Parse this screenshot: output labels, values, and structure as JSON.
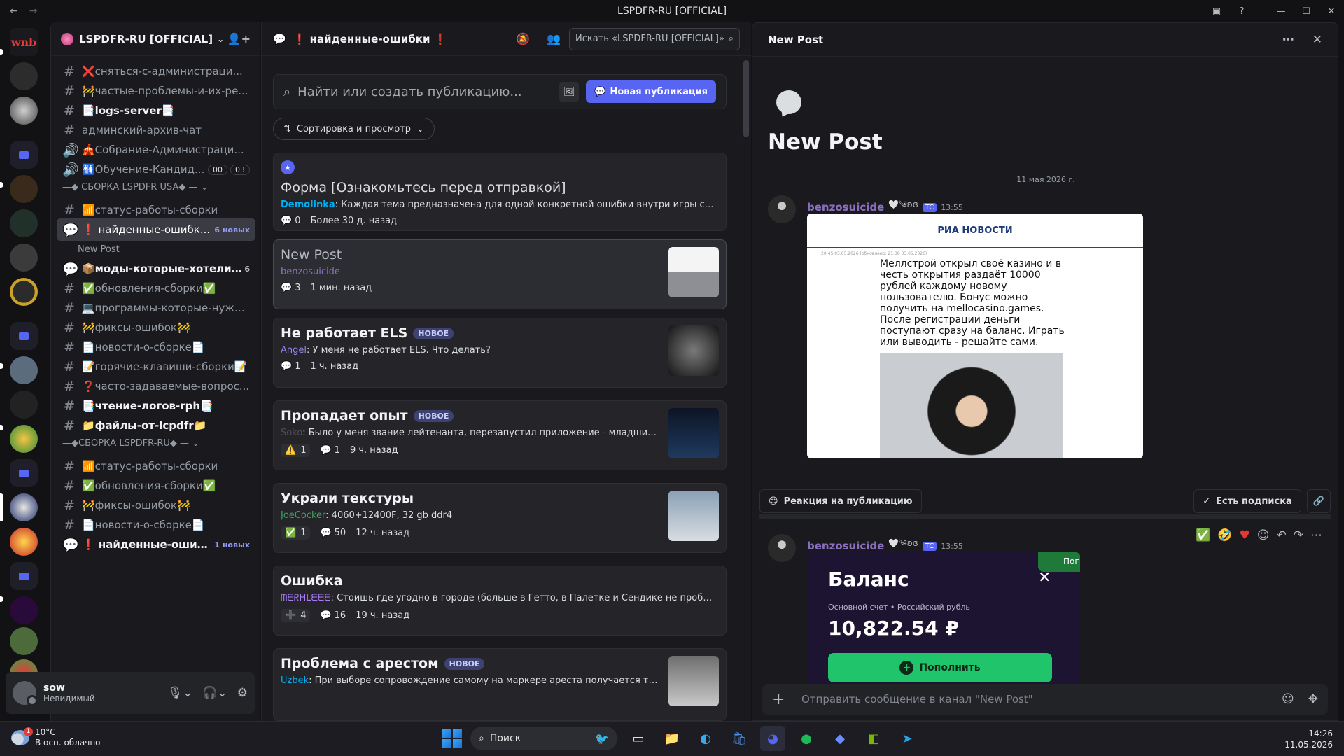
{
  "window": {
    "title": "LSPDFR-RU [OFFICIAL]",
    "back_icon": "arrow-left-icon",
    "forward_icon": "arrow-right-icon"
  },
  "server_sidebar": {
    "items": [
      "wnb"
    ]
  },
  "channels": {
    "guild_name": "LSPDFR-RU [OFFICIAL]",
    "items": [
      {
        "label": "❌сняться-с-администраци...",
        "type": "text"
      },
      {
        "label": "🚧частые-проблемы-и-их-ре...",
        "type": "text"
      },
      {
        "label": "📑logs-server📑",
        "type": "text"
      },
      {
        "label": "админский-архив-чат",
        "type": "text"
      },
      {
        "label": "🎪Собрание-Администраци...",
        "type": "voice"
      },
      {
        "label": "🚻Обучение-Кандид...",
        "type": "voice",
        "counts": [
          "00",
          "03"
        ]
      },
      {
        "label": "📶статус-работы-сборки",
        "type": "text"
      },
      {
        "label": "❗ найденные-ошибк...",
        "type": "forum",
        "badge": "6 новых"
      },
      {
        "label": "New Post",
        "type": "thread"
      },
      {
        "label": "📦моды-которые-хотели-б...",
        "type": "forum",
        "badge": "6"
      },
      {
        "label": "✅обновления-сборки✅",
        "type": "text"
      },
      {
        "label": "💻программы-которые-нужн...",
        "type": "text"
      },
      {
        "label": "🚧фиксы-ошибок🚧",
        "type": "text"
      },
      {
        "label": "📄новости-о-сборке📄",
        "type": "text"
      },
      {
        "label": "📝горячие-клавиши-сборки📝",
        "type": "text"
      },
      {
        "label": "❓часто-задаваемые-вопрос...",
        "type": "text"
      },
      {
        "label": "📑чтение-логов-rph📑",
        "type": "text"
      },
      {
        "label": "📁файлы-от-lcpdfr📁",
        "type": "text"
      },
      {
        "label": "📶статус-работы-сборки",
        "type": "text"
      },
      {
        "label": "✅обновления-сборки✅",
        "type": "text"
      },
      {
        "label": "🚧фиксы-ошибок🚧",
        "type": "text"
      },
      {
        "label": "📄новости-о-сборке📄",
        "type": "text"
      },
      {
        "label": "❗ найденные-ошибки...",
        "type": "forum",
        "badge": "1 новых"
      }
    ],
    "categories": [
      "—◆ СБОРКА LSPDFR USA◆ —",
      "—◆СБОРКА LSPDFR-RU◆ —"
    ]
  },
  "user": {
    "name": "sow",
    "status": "Невидимый"
  },
  "forum": {
    "channel_name": "❗ найденные-ошибки ❗",
    "search_placeholder": "Искать «LSPDFR-RU [OFFICIAL]»",
    "post_search_placeholder": "Найти или создать публикацию...",
    "new_post_label": "Новая публикация",
    "sort_label": "Сортировка и просмотр",
    "posts": [
      {
        "title": "Форма [Ознакомьтесь перед отправкой]",
        "author": "Demolinka",
        "author_color": "#00b0f4",
        "preview": "Каждая тема предназначена для одной конкретной ошибки внутри игры со сборкой. П...",
        "comments": "0",
        "time": "Более 30 д. назад",
        "pinned": true
      },
      {
        "title": "New Post",
        "author": "benzosuicide",
        "author_color": "#8a6fbf",
        "preview": "",
        "comments": "3",
        "time": "1 мин. назад",
        "selected": true
      },
      {
        "title": "Не работает ELS",
        "tag": "НОВОЕ",
        "author": "Angel",
        "author_color": "#9b84ec",
        "preview": "У меня не работает ELS. Что делать?",
        "comments": "1",
        "time": "1 ч. назад"
      },
      {
        "title": "Пропадает опыт",
        "tag": "НОВОЕ",
        "author": "Soko",
        "author_color": "#4e5058",
        "preview": "Было у меня звание лейтенанта, перезапустил приложение - младший лейтен...",
        "reaction": "⚠️",
        "reaction_count": "1",
        "comments": "1",
        "time": "9 ч. назад"
      },
      {
        "title": "Украли текстуры",
        "author": "JoeCocker",
        "author_color": "#3ba55d",
        "preview": "4060+12400F, 32 gb ddr4",
        "reaction": "✅",
        "reaction_count": "1",
        "comments": "50",
        "time": "12 ч. назад"
      },
      {
        "title": "Ошибка",
        "author": "ᗰᗴᖇᕼᒪᗴᗴᗴ",
        "author_color": "#a87bf5",
        "preview": "Стоишь где угодно в городе (больше в Гетто, в Палетке и Сендике не пробовал ещё), ...",
        "reaction": "➕",
        "reaction_count": "4",
        "comments": "16",
        "time": "19 ч. назад"
      },
      {
        "title": "Проблема с арестом",
        "tag": "НОВОЕ",
        "author": "Uzbek",
        "author_color": "#00b0f4",
        "preview": "При выборе сопровождение самому на маркере ареста получается так что ты..."
      }
    ]
  },
  "thread": {
    "header": "New Post",
    "title": "New Post",
    "date_divider": "11 мая 2026 г.",
    "messages": [
      {
        "author": "benzosuicide",
        "badge": "TC",
        "time": "13:55",
        "deco": "🤍༄ʚɞ",
        "embed": {
          "logo": "РИА НОВОСТИ",
          "meta": "20:45 03.05.2026  (обновлено: 21:38 03.05.2026)",
          "text": "Меллстрой открыл своё казино и в честь открытия раздаёт 10000 рублей каждому новому пользователю. Бонус можно получить на mellocasino.games. После регистрации деньги поступают сразу на баланс. Играть или выводить - решайте сами."
        }
      },
      {
        "author": "benzosuicide",
        "badge": "TC",
        "time": "13:55",
        "deco": "🤍༄ʚɞ",
        "embed": {
          "title": "Баланс",
          "account": "Основной счет • Российский рубль",
          "amount": "10,822.54 ₽",
          "button": "Пополнить",
          "corner": "Пог"
        }
      }
    ],
    "reaction_label": "Реакция на публикацию",
    "follow_label": "Есть подписка",
    "composer_placeholder": "Отправить сообщение в канал \"New Post\""
  },
  "taskbar": {
    "weather_temp": "10°C",
    "weather_desc": "В осн. облачно",
    "search_label": "Поиск",
    "time": "14:26",
    "date": "11.05.2026"
  }
}
